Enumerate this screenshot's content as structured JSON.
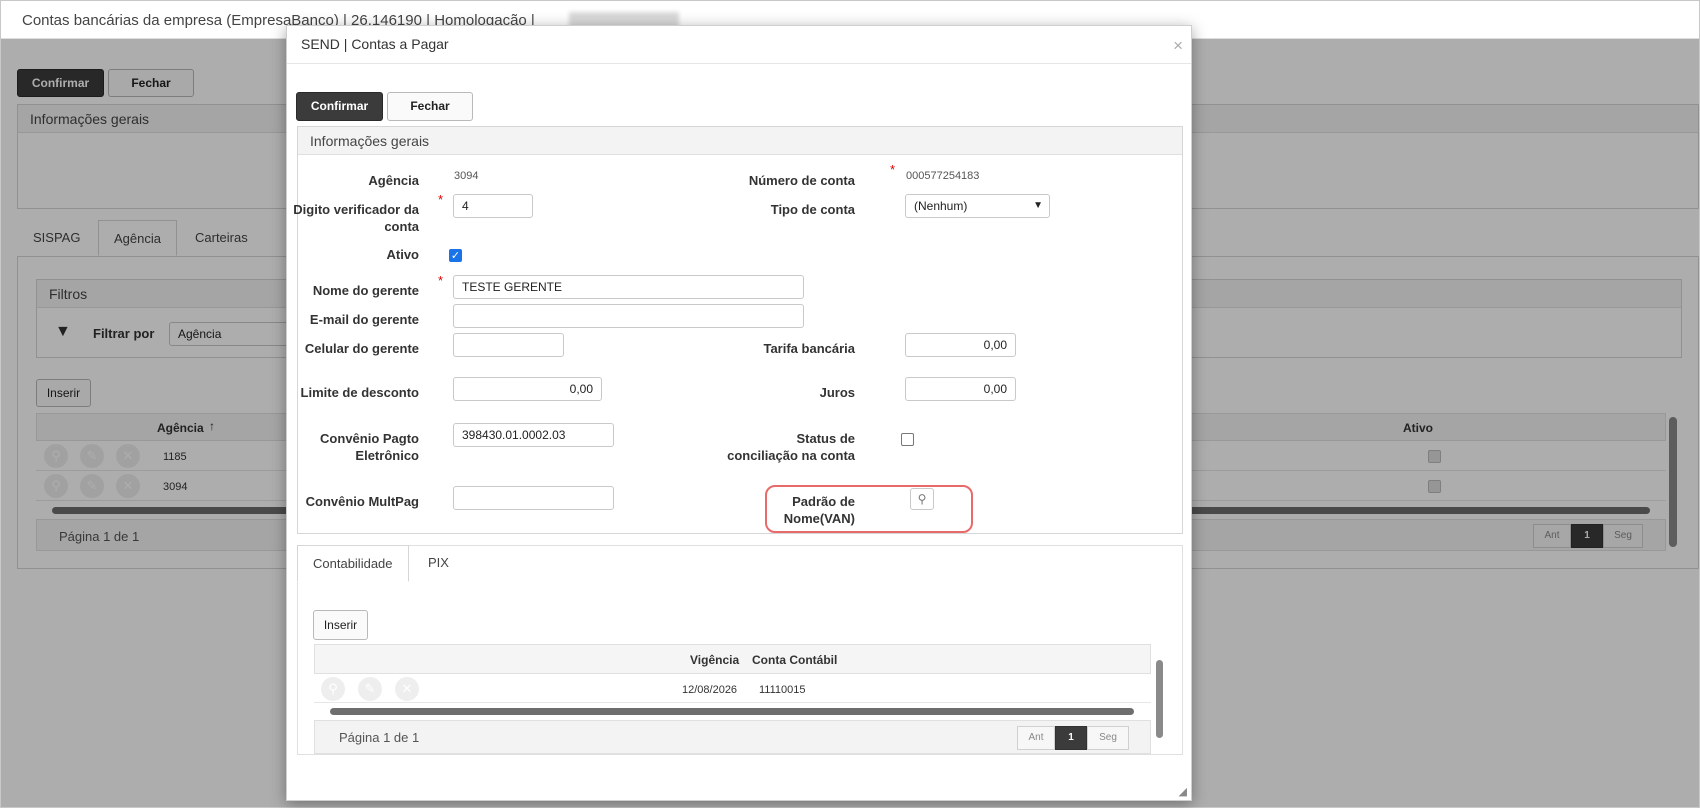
{
  "window": {
    "title": "Contas bancárias da empresa (EmpresaBanco) | 26.146190 | Homologação |"
  },
  "bg": {
    "confirm_label": "Confirmar",
    "close_label": "Fechar",
    "info_header": "Informações gerais",
    "tabs": [
      "SISPAG",
      "Agência",
      "Carteiras"
    ],
    "filters_header": "Filtros",
    "filter_by_label": "Filtrar por",
    "filter_value": "Agência",
    "insert_label": "Inserir",
    "grid_col_agencia": "Agência",
    "grid_col_ativo": "Ativo",
    "rows": [
      {
        "agencia": "1185"
      },
      {
        "agencia": "3094"
      }
    ],
    "pagination_text": "Página 1 de 1",
    "pager_prev": "Ant",
    "pager_current": "1",
    "pager_next": "Seg"
  },
  "modal": {
    "title": "SEND | Contas a Pagar",
    "close_glyph": "×",
    "confirm_label": "Confirmar",
    "close_label": "Fechar",
    "section_title": "Informações gerais",
    "req_mark": "*",
    "fields": {
      "agencia_label": "Agência",
      "agencia_value": "3094",
      "numero_conta_label": "Número de conta",
      "numero_conta_value": "000577254183",
      "digito_label": "Digito verificador da conta",
      "digito_value": "4",
      "tipo_conta_label": "Tipo de conta",
      "tipo_conta_value": "(Nenhum)",
      "ativo_label": "Ativo",
      "ativo_checked": true,
      "nome_gerente_label": "Nome do gerente",
      "nome_gerente_value": "TESTE GERENTE",
      "email_gerente_label": "E-mail do gerente",
      "email_gerente_value": "",
      "celular_gerente_label": "Celular do gerente",
      "celular_gerente_value": "",
      "tarifa_label": "Tarifa bancária",
      "tarifa_value": "0,00",
      "limite_label": "Limite de desconto",
      "limite_value": "0,00",
      "juros_label": "Juros",
      "juros_value": "0,00",
      "convenio_pagto_label": "Convênio Pagto Eletrônico",
      "convenio_pagto_value": "398430.01.0002.03",
      "status_conciliacao_label": "Status de conciliação na conta",
      "status_conciliacao_checked": false,
      "convenio_multpag_label": "Convênio MultPag",
      "convenio_multpag_value": "",
      "padrao_nome_label": "Padrão de Nome(VAN)"
    },
    "subtabs": [
      "Contabilidade",
      "PIX"
    ],
    "insert_label": "Inserir",
    "grid": {
      "col_vigencia": "Vigência",
      "col_conta": "Conta Contábil",
      "rows": [
        {
          "vigencia": "12/08/2026",
          "conta": "11110015"
        }
      ]
    },
    "pagination_text": "Página 1 de 1",
    "pager_prev": "Ant",
    "pager_current": "1",
    "pager_next": "Seg"
  },
  "colors": {
    "dark_button": "#3b3b3b",
    "required": "#e00000",
    "highlight": "#e86a6a",
    "checkbox": "#1a73e8"
  }
}
